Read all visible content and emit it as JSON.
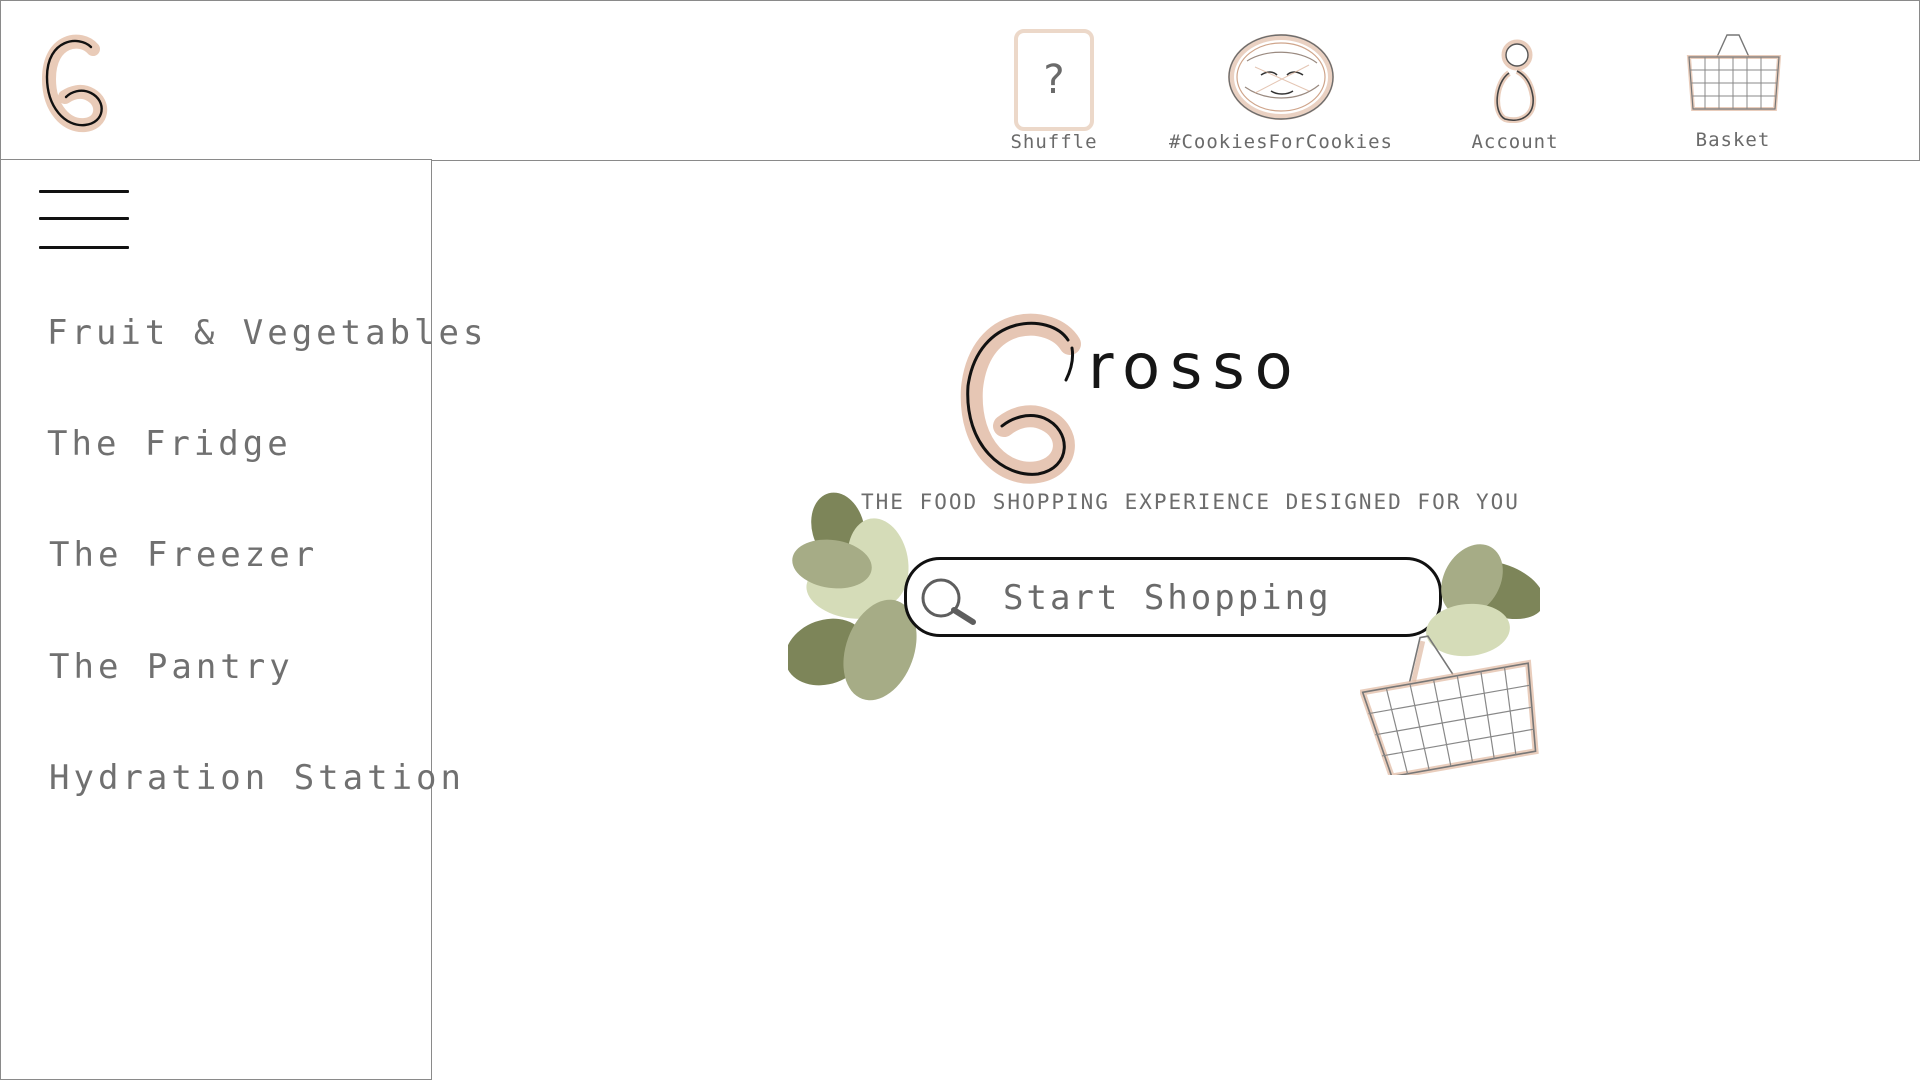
{
  "header": {
    "nav": {
      "shuffle": {
        "label": "Shuffle",
        "glyph": "?",
        "icon": "question-mark-card-icon"
      },
      "cookies": {
        "label": "#CookiesForCookies",
        "icon": "cookie-face-icon"
      },
      "account": {
        "label": "Account",
        "icon": "person-icon"
      },
      "basket": {
        "label": "Basket",
        "icon": "shopping-basket-icon"
      }
    }
  },
  "sidebar": {
    "menu_icon": "hamburger-menu-icon",
    "items": [
      {
        "label": "Fruit & Vegetables"
      },
      {
        "label": "The Fridge"
      },
      {
        "label": "The Freezer"
      },
      {
        "label": "The Pantry"
      },
      {
        "label": "Hydration Station"
      }
    ]
  },
  "main": {
    "brand_word": "rosso",
    "tagline": "THE FOOD SHOPPING EXPERIENCE DESIGNED FOR YOU",
    "search": {
      "placeholder": "Start Shopping",
      "icon": "magnifier-icon"
    }
  },
  "colors": {
    "accent_peach": "#d9ad93",
    "leaf_dark": "#7d8559",
    "leaf_mid": "#a6ac86",
    "leaf_light": "#d5dcb8",
    "border": "#8a8a8a",
    "text": "#6f6f6f"
  }
}
